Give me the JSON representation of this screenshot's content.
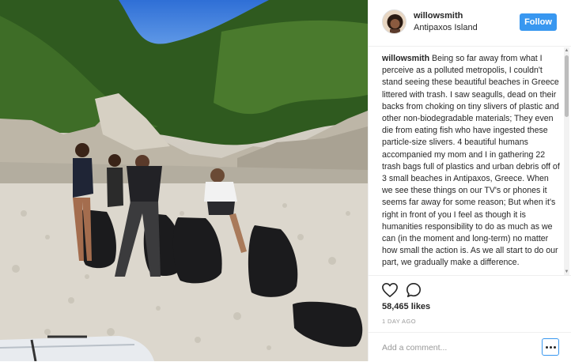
{
  "post": {
    "photo_description_icon": "photo",
    "username": "willowsmith",
    "location": "Antipaxos Island",
    "follow_label": "Follow",
    "caption_username": "willowsmith",
    "caption_text": "Being so far away from what I perceive as a polluted metropolis, I couldn't stand seeing these beautiful beaches in Greece littered with trash. I saw seagulls, dead on their backs from choking on tiny slivers of plastic and other non-biodegradable materials; They even die from eating fish who have ingested these particle-size slivers. 4 beautiful humans accompanied my mom and I in gathering 22 trash bags full of plastics and urban debris off of 3 small beaches in Antipaxos, Greece. When we see these things on our TV's or phones it seems far away for some reason; But when it's right in front of you I feel as though it is humanities responsibility to do as much as we can (in the moment and long-term) no matter how small the action is. As we all start to do our part, we gradually make a difference.",
    "likes": "58,465 likes",
    "timestamp": "1 DAY AGO",
    "comment_placeholder": "Add a comment...",
    "icons": {
      "like": "heart-icon",
      "comment": "comment-icon",
      "more": "more-options-icon"
    },
    "colors": {
      "accent": "#3897f0",
      "text": "#262626",
      "muted": "#999999"
    }
  }
}
